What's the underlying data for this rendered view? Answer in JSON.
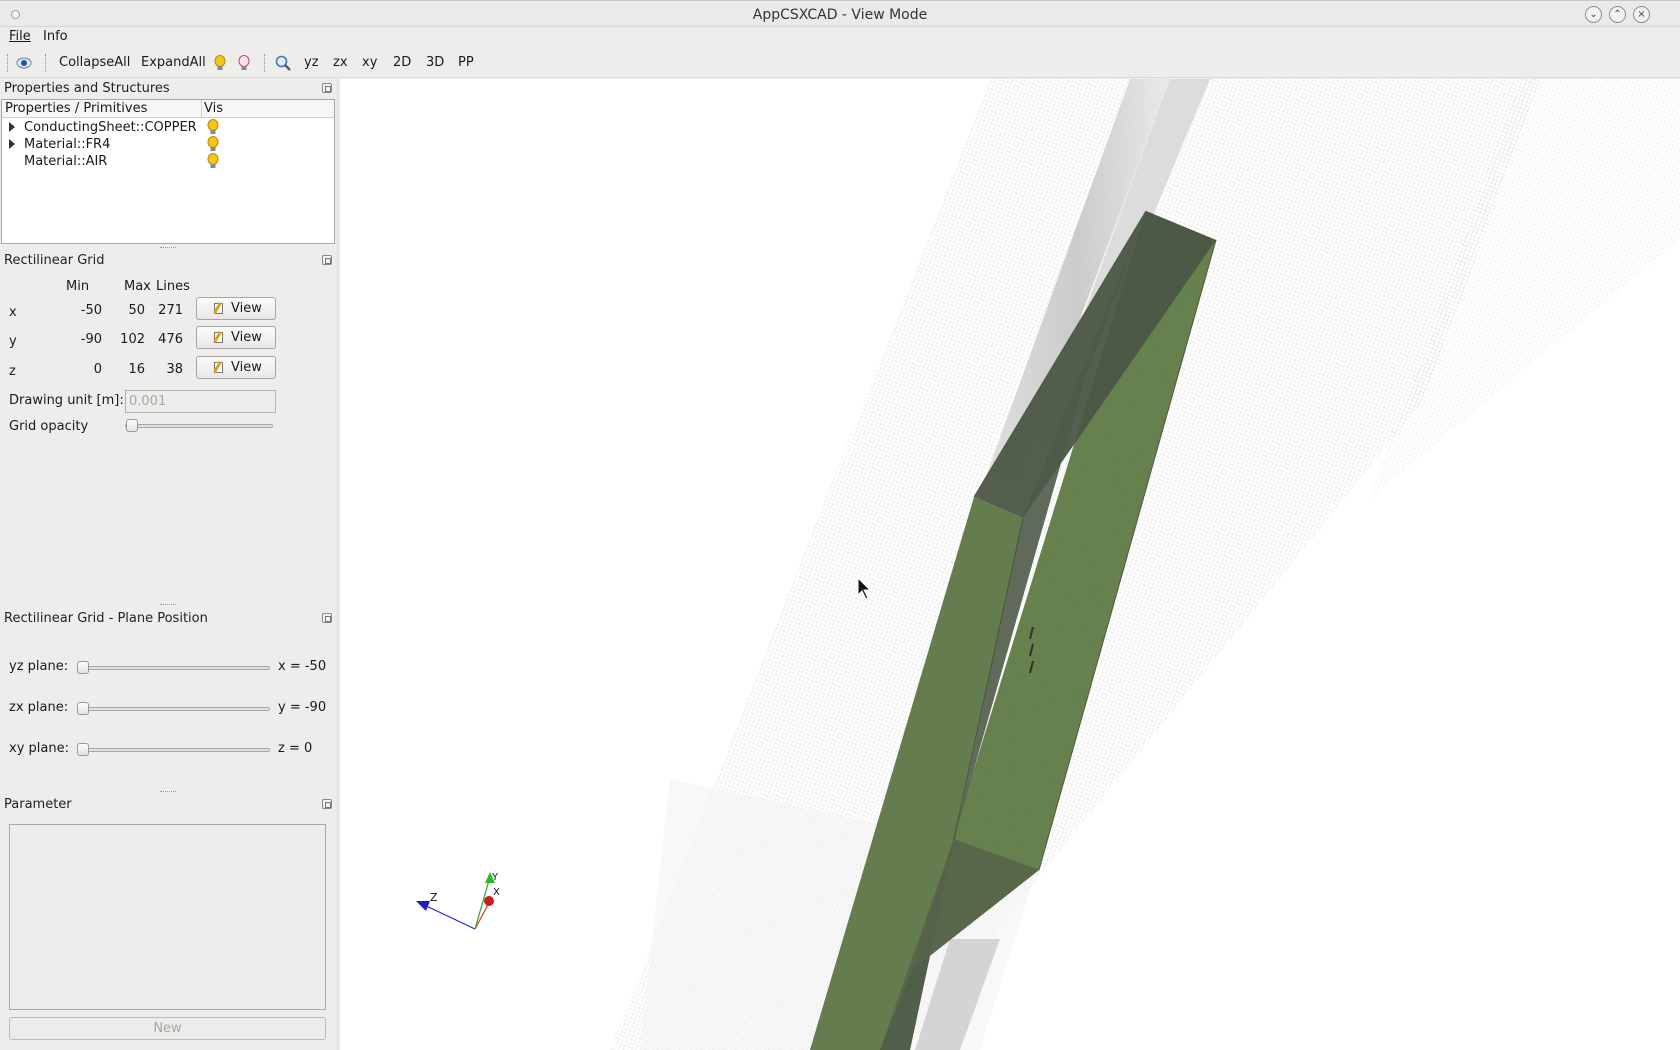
{
  "window": {
    "title": "AppCSXCAD - View Mode",
    "controls": [
      "⌄",
      "⌃",
      "×"
    ]
  },
  "menubar": {
    "file": "File",
    "info": "Info"
  },
  "toolbar": {
    "collapse_all": "CollapseAll",
    "expand_all": "ExpandAll",
    "yz": "yz",
    "zx": "zx",
    "xy": "xy",
    "view_2d": "2D",
    "view_3d": "3D",
    "pp": "PP"
  },
  "properties_panel": {
    "title": "Properties and Structures",
    "columns": [
      "Properties / Primitives",
      "Vis"
    ],
    "items": [
      {
        "label": "ConductingSheet::COPPER",
        "expandable": true
      },
      {
        "label": "Material::FR4",
        "expandable": true
      },
      {
        "label": "Material::AIR",
        "expandable": false
      }
    ]
  },
  "grid_panel": {
    "title": "Rectilinear Grid",
    "headers": {
      "min": "Min",
      "max": "Max",
      "lines": "Lines"
    },
    "rows": [
      {
        "axis": "x",
        "min": "-50",
        "max": "50",
        "lines": "271",
        "button": "View"
      },
      {
        "axis": "y",
        "min": "-90",
        "max": "102",
        "lines": "476",
        "button": "View"
      },
      {
        "axis": "z",
        "min": "0",
        "max": "16",
        "lines": "38",
        "button": "View"
      }
    ],
    "drawing_unit_label": "Drawing unit [m]:",
    "drawing_unit_value": "0.001",
    "grid_opacity_label": "Grid opacity",
    "grid_opacity_value": 0.0
  },
  "plane_panel": {
    "title": "Rectilinear Grid - Plane Position",
    "planes": [
      {
        "label": "yz plane:",
        "readout": "x = -50",
        "value": 0.0
      },
      {
        "label": "zx plane:",
        "readout": "y = -90",
        "value": 0.0
      },
      {
        "label": "xy plane:",
        "readout": "z = 0",
        "value": 0.0
      }
    ]
  },
  "parameter_panel": {
    "title": "Parameter",
    "new_button": "New"
  },
  "axes_widget": {
    "x": "X",
    "y": "Y",
    "z": "Z"
  },
  "colors": {
    "substrate_green": "#5f7a45",
    "substrate_dark": "#4b5645",
    "bulb_yellow": "#f5c518"
  }
}
